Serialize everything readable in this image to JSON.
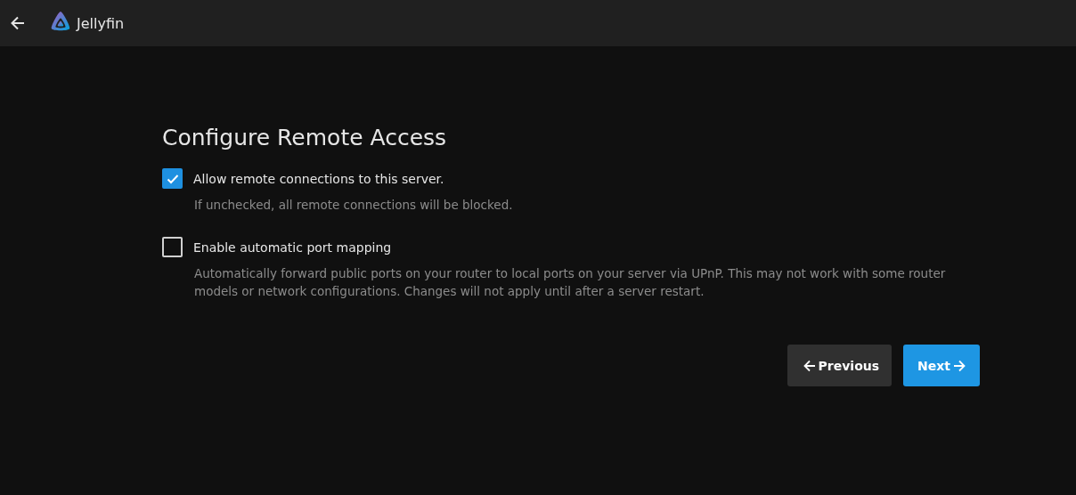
{
  "header": {
    "app_name": "Jellyfin"
  },
  "page": {
    "title": "Configure Remote Access",
    "options": [
      {
        "label": "Allow remote connections to this server.",
        "description": "If unchecked, all remote connections will be blocked.",
        "checked": true
      },
      {
        "label": "Enable automatic port mapping",
        "description": "Automatically forward public ports on your router to local ports on your server via UPnP. This may not work with some router models or network configurations. Changes will not apply until after a server restart.",
        "checked": false
      }
    ],
    "buttons": [
      {
        "label": "Previous",
        "kind": "previous"
      },
      {
        "label": "Next",
        "kind": "next"
      }
    ]
  }
}
